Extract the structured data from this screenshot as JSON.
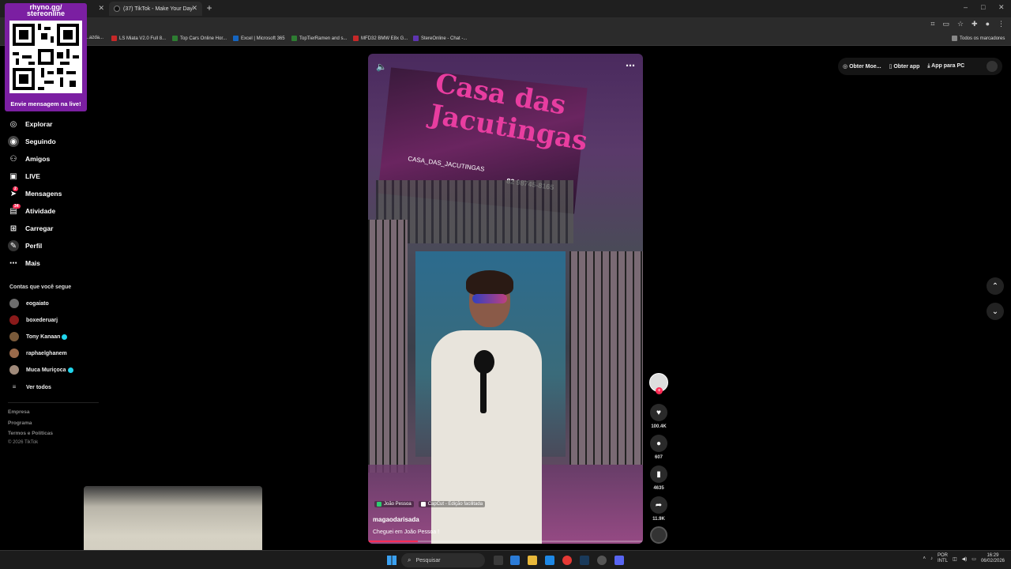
{
  "browser": {
    "tabs": [
      {
        "label": "(37) TikTok - Make Your Day",
        "active": false
      }
    ],
    "bookmarks": [
      "...azda...",
      "LS Miata V2.0 Full 8...",
      "Top Cars Online Hor...",
      "Excel | Microsoft 365",
      "TopTierRamen and s...",
      "MFD32 BMW E8x G...",
      "StereOnline - Chat -..."
    ],
    "bookmarks_folder": "Todos os marcadores"
  },
  "overlay": {
    "url_line1": "rhyno.gg/",
    "url_line2": "stereonline",
    "caption": "Envie mensagem na live!"
  },
  "nav": {
    "items": [
      {
        "label": "Explorar",
        "icon": "compass-icon"
      },
      {
        "label": "Seguindo",
        "icon": "following-icon"
      },
      {
        "label": "Amigos",
        "icon": "friends-icon"
      },
      {
        "label": "LIVE",
        "icon": "live-icon"
      },
      {
        "label": "Mensagens",
        "icon": "messages-icon",
        "badge": "2"
      },
      {
        "label": "Atividade",
        "icon": "activity-icon",
        "badge": "34"
      },
      {
        "label": "Carregar",
        "icon": "upload-icon"
      },
      {
        "label": "Perfil",
        "icon": "profile-icon"
      },
      {
        "label": "Mais",
        "icon": "more-icon"
      }
    ]
  },
  "following": {
    "title": "Contas que você segue",
    "accounts": [
      {
        "name": "eogaiato",
        "verified": false
      },
      {
        "name": "boxederuarj",
        "verified": false
      },
      {
        "name": "Tony Kanaan",
        "verified": true
      },
      {
        "name": "raphaelghanem",
        "verified": false
      },
      {
        "name": "Muca Muriçoca",
        "verified": true
      }
    ],
    "see_all": "Ver todos"
  },
  "footer": {
    "links": [
      "Empresa",
      "Programa",
      "Termos e Políticas"
    ],
    "copyright": "© 2026 TikTok"
  },
  "video": {
    "sign_title": "Casa das Jacutingas",
    "sign_handle": "CASA_DAS_JACUTINGAS",
    "sign_phone": "82 98745-8165",
    "location_tag": "João Pessoa",
    "capcut_tag": "CapCut - Edição facilitada",
    "author": "magaodarisada",
    "caption": "Cheguei em João Pessoa !",
    "progress": 0.18
  },
  "actions": {
    "likes": "100.4K",
    "comments": "607",
    "saves": "4635",
    "shares": "11.9K"
  },
  "topbar": {
    "coins": "Obter Moe...",
    "get_app": "Obter app",
    "pc_app": "App para PC"
  },
  "taskbar": {
    "search_placeholder": "Pesquisar",
    "lang_line1": "POR",
    "lang_line2": "INTL",
    "time": "16:29",
    "date": "06/02/2026"
  }
}
